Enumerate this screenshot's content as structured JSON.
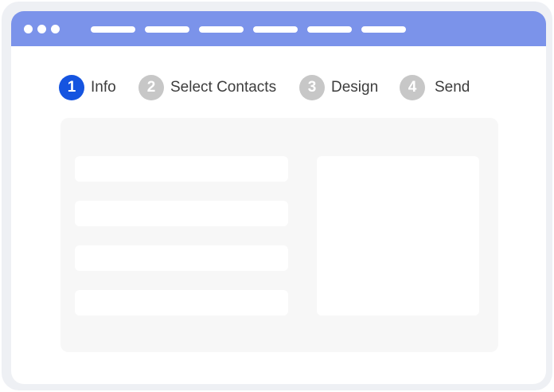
{
  "window": {
    "titlebar_color": "#7b93ea",
    "window_controls": [
      "dot",
      "dot",
      "dot"
    ],
    "tab_placeholders": 6
  },
  "stepper": {
    "active_color": "#1554e0",
    "inactive_color": "#c7c7c7",
    "steps": [
      {
        "number": "1",
        "label": "Info",
        "state": "active"
      },
      {
        "number": "2",
        "label": "Select Contacts",
        "state": "inactive"
      },
      {
        "number": "3",
        "label": "Design",
        "state": "inactive"
      },
      {
        "number": "4",
        "label": "Send",
        "state": "inactive"
      }
    ]
  },
  "form": {
    "fields": [
      {
        "value": ""
      },
      {
        "value": ""
      },
      {
        "value": ""
      },
      {
        "value": ""
      }
    ],
    "preview": {
      "content": ""
    }
  }
}
